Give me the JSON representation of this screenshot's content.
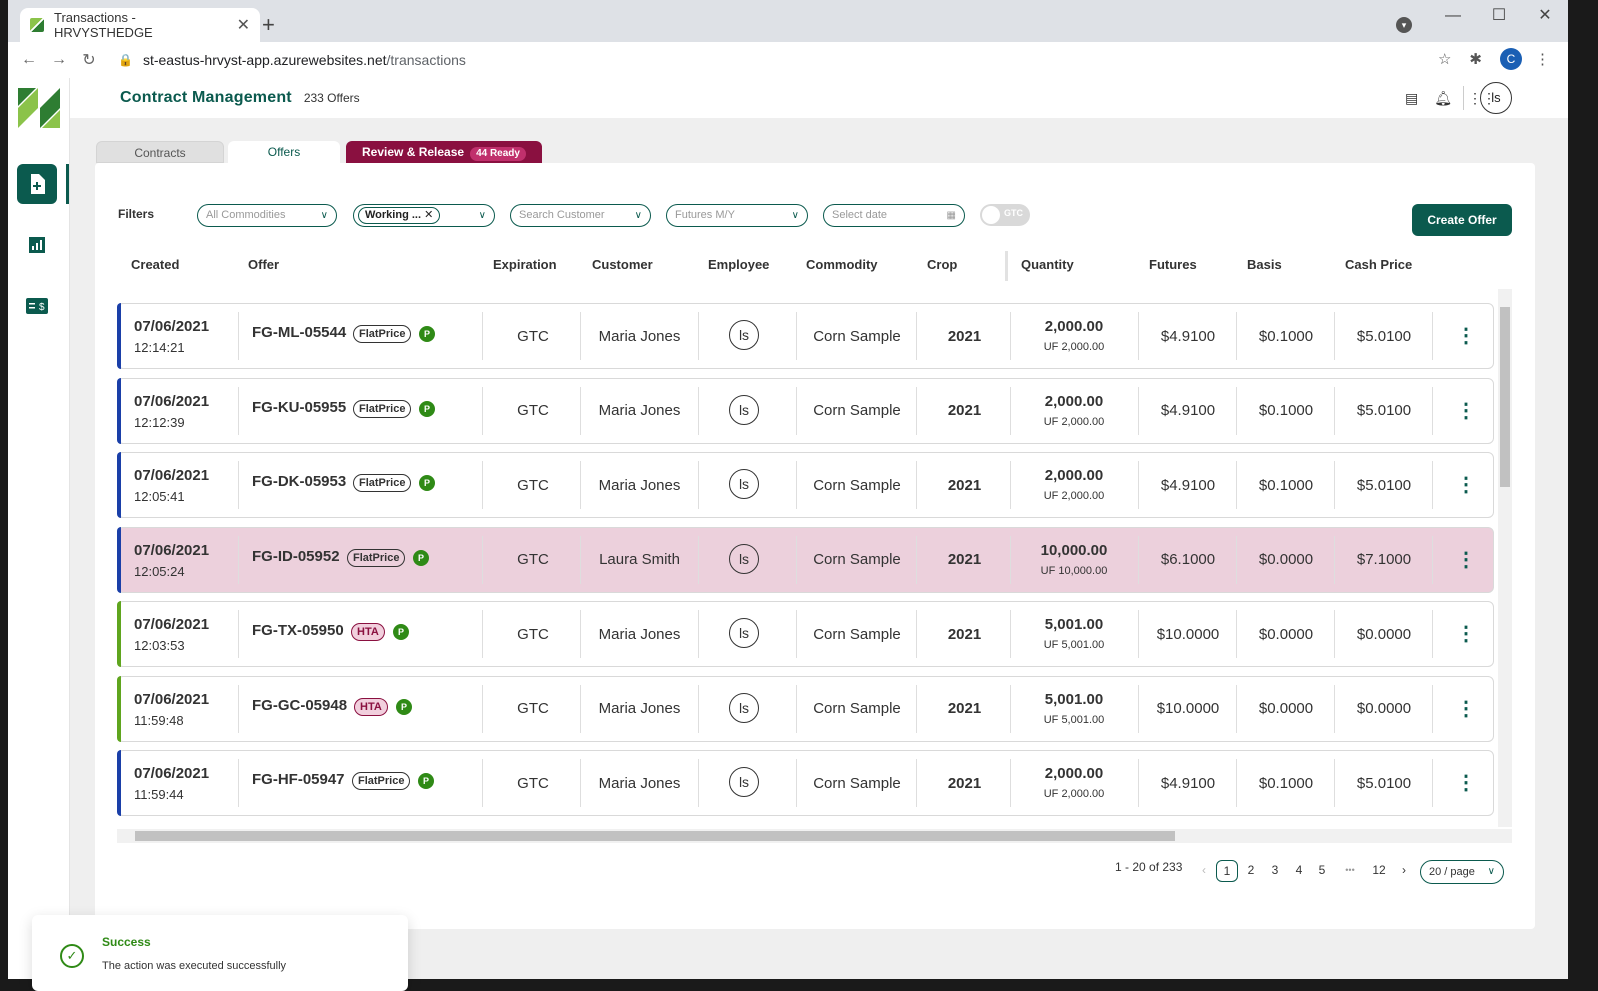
{
  "browser": {
    "tab_title": "Transactions - HRVYSTHEDGE",
    "url_host": "st-eastus-hrvyst-app.azurewebsites.net",
    "url_path": "/transactions",
    "profile_initial": "C"
  },
  "header": {
    "title": "Contract Management",
    "count": "233 Offers",
    "avatar": "ls"
  },
  "tabs": {
    "contracts": "Contracts",
    "offers": "Offers",
    "review": "Review & Release",
    "review_badge": "44 Ready"
  },
  "filters": {
    "label": "Filters",
    "commodities_placeholder": "All Commodities",
    "status_chip": "Working ...",
    "customer_placeholder": "Search Customer",
    "futures_placeholder": "Futures M/Y",
    "date_placeholder": "Select date",
    "gtc_label": "GTC"
  },
  "create_offer": "Create Offer",
  "columns": [
    "Created",
    "Offer",
    "Expiration",
    "Customer",
    "Employee",
    "Commodity",
    "Crop",
    "Quantity",
    "Futures",
    "Basis",
    "Cash Price"
  ],
  "rows": [
    {
      "date": "07/06/2021",
      "time": "12:14:21",
      "offer": "FG-ML-05544",
      "type": "FlatPrice",
      "p": "P",
      "exp": "GTC",
      "customer": "Maria Jones",
      "emp": "ls",
      "commodity": "Corn Sample",
      "crop": "2021",
      "qty": "2,000.00",
      "uf": "UF 2,000.00",
      "futures": "$4.9100",
      "basis": "$0.1000",
      "cash": "$5.0100",
      "edge": "#1a3fa8",
      "highlight": false
    },
    {
      "date": "07/06/2021",
      "time": "12:12:39",
      "offer": "FG-KU-05955",
      "type": "FlatPrice",
      "p": "P",
      "exp": "GTC",
      "customer": "Maria Jones",
      "emp": "ls",
      "commodity": "Corn Sample",
      "crop": "2021",
      "qty": "2,000.00",
      "uf": "UF 2,000.00",
      "futures": "$4.9100",
      "basis": "$0.1000",
      "cash": "$5.0100",
      "edge": "#1a3fa8",
      "highlight": false
    },
    {
      "date": "07/06/2021",
      "time": "12:05:41",
      "offer": "FG-DK-05953",
      "type": "FlatPrice",
      "p": "P",
      "exp": "GTC",
      "customer": "Maria Jones",
      "emp": "ls",
      "commodity": "Corn Sample",
      "crop": "2021",
      "qty": "2,000.00",
      "uf": "UF 2,000.00",
      "futures": "$4.9100",
      "basis": "$0.1000",
      "cash": "$5.0100",
      "edge": "#1a3fa8",
      "highlight": false
    },
    {
      "date": "07/06/2021",
      "time": "12:05:24",
      "offer": "FG-ID-05952",
      "type": "FlatPrice",
      "p": "P",
      "exp": "GTC",
      "customer": "Laura Smith",
      "emp": "ls",
      "commodity": "Corn Sample",
      "crop": "2021",
      "qty": "10,000.00",
      "uf": "UF 10,000.00",
      "futures": "$6.1000",
      "basis": "$0.0000",
      "cash": "$7.1000",
      "edge": "#1a3fa8",
      "highlight": true
    },
    {
      "date": "07/06/2021",
      "time": "12:03:53",
      "offer": "FG-TX-05950",
      "type": "HTA",
      "p": "P",
      "exp": "GTC",
      "customer": "Maria Jones",
      "emp": "ls",
      "commodity": "Corn Sample",
      "crop": "2021",
      "qty": "5,001.00",
      "uf": "UF 5,001.00",
      "futures": "$10.0000",
      "basis": "$0.0000",
      "cash": "$0.0000",
      "edge": "#5fa51e",
      "highlight": false
    },
    {
      "date": "07/06/2021",
      "time": "11:59:48",
      "offer": "FG-GC-05948",
      "type": "HTA",
      "p": "P",
      "exp": "GTC",
      "customer": "Maria Jones",
      "emp": "ls",
      "commodity": "Corn Sample",
      "crop": "2021",
      "qty": "5,001.00",
      "uf": "UF 5,001.00",
      "futures": "$10.0000",
      "basis": "$0.0000",
      "cash": "$0.0000",
      "edge": "#5fa51e",
      "highlight": false
    },
    {
      "date": "07/06/2021",
      "time": "11:59:44",
      "offer": "FG-HF-05947",
      "type": "FlatPrice",
      "p": "P",
      "exp": "GTC",
      "customer": "Maria Jones",
      "emp": "ls",
      "commodity": "Corn Sample",
      "crop": "2021",
      "qty": "2,000.00",
      "uf": "UF 2,000.00",
      "futures": "$4.9100",
      "basis": "$0.1000",
      "cash": "$5.0100",
      "edge": "#1a3fa8",
      "highlight": false
    }
  ],
  "pagination": {
    "range": "1 - 20 of 233",
    "pages": [
      "1",
      "2",
      "3",
      "4",
      "5",
      "•••",
      "12"
    ],
    "current": "1",
    "page_size": "20 / page"
  },
  "toast": {
    "title": "Success",
    "message": "The action was executed successfully"
  }
}
